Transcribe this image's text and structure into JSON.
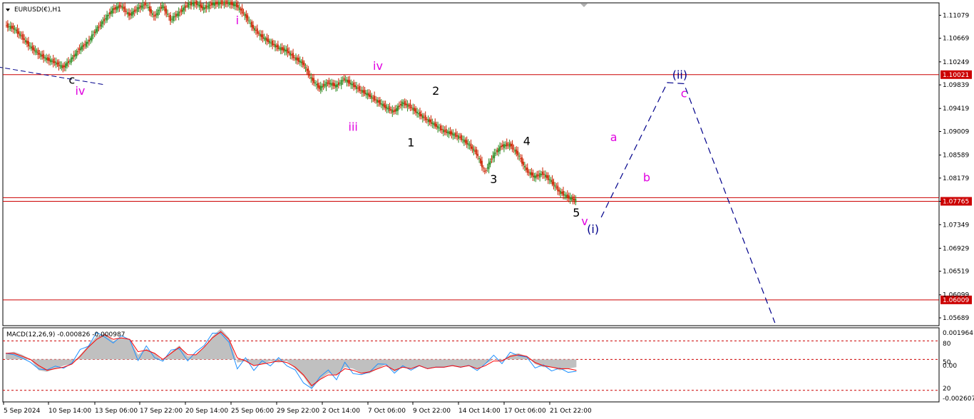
{
  "window": {
    "symbol_label": "EURUSD(€),H1",
    "indicator_label": "MACD(12,26,9) -0.000826 -0.000987"
  },
  "chart_data": [
    {
      "type": "line",
      "title": "EURUSD(€),H1",
      "yaxis_ticks": [
        "1.11079",
        "1.10669",
        "1.10249",
        "1.09839",
        "1.09419",
        "1.09009",
        "1.08589",
        "1.08179",
        "1.07765",
        "1.07349",
        "1.06929",
        "1.06519",
        "1.06099",
        "1.05689"
      ],
      "xaxis_ticks": [
        "5 Sep 2024",
        "10 Sep 14:00",
        "13 Sep 06:00",
        "17 Sep 22:00",
        "20 Sep 14:00",
        "25 Sep 06:00",
        "29 Sep 22:00",
        "2 Oct 14:00",
        "7 Oct 06:00",
        "9 Oct 22:00",
        "14 Oct 14:00",
        "17 Oct 06:00",
        "21 Oct 22:00"
      ],
      "ylim": [
        1.0555,
        1.113
      ],
      "price_path": [
        [
          0,
          1.109
        ],
        [
          1,
          1.1085
        ],
        [
          2,
          1.107
        ],
        [
          3,
          1.1052
        ],
        [
          4,
          1.104
        ],
        [
          5,
          1.103
        ],
        [
          6,
          1.1024
        ],
        [
          7,
          1.1015
        ],
        [
          8,
          1.103
        ],
        [
          9,
          1.1048
        ],
        [
          10,
          1.106
        ],
        [
          11,
          1.1082
        ],
        [
          12,
          1.11
        ],
        [
          13,
          1.1118
        ],
        [
          14,
          1.1125
        ],
        [
          15,
          1.1108
        ],
        [
          16,
          1.112
        ],
        [
          17,
          1.1128
        ],
        [
          18,
          1.1105
        ],
        [
          19,
          1.1125
        ],
        [
          20,
          1.11
        ],
        [
          21,
          1.1112
        ],
        [
          22,
          1.1126
        ],
        [
          23,
          1.113
        ],
        [
          24,
          1.112
        ],
        [
          25,
          1.1128
        ],
        [
          26,
          1.113
        ],
        [
          27,
          1.113
        ],
        [
          28,
          1.1125
        ],
        [
          29,
          1.1108
        ],
        [
          30,
          1.1085
        ],
        [
          31,
          1.107
        ],
        [
          32,
          1.106
        ],
        [
          33,
          1.105
        ],
        [
          34,
          1.1045
        ],
        [
          35,
          1.1032
        ],
        [
          36,
          1.1022
        ],
        [
          37,
          1.0995
        ],
        [
          38,
          1.0978
        ],
        [
          39,
          1.0988
        ],
        [
          40,
          1.0982
        ],
        [
          41,
          1.0994
        ],
        [
          42,
          1.0984
        ],
        [
          43,
          1.0974
        ],
        [
          44,
          1.0965
        ],
        [
          45,
          1.0955
        ],
        [
          46,
          1.0944
        ],
        [
          47,
          1.0936
        ],
        [
          48,
          1.0952
        ],
        [
          49,
          1.0945
        ],
        [
          50,
          1.0932
        ],
        [
          51,
          1.0922
        ],
        [
          52,
          1.0912
        ],
        [
          53,
          1.0902
        ],
        [
          54,
          1.0897
        ],
        [
          55,
          1.089
        ],
        [
          56,
          1.0878
        ],
        [
          57,
          1.0862
        ],
        [
          58,
          1.0828
        ],
        [
          59,
          1.0858
        ],
        [
          60,
          1.0875
        ],
        [
          61,
          1.0878
        ],
        [
          62,
          1.086
        ],
        [
          63,
          1.0832
        ],
        [
          64,
          1.082
        ],
        [
          65,
          1.0826
        ],
        [
          66,
          1.0812
        ],
        [
          67,
          1.0794
        ],
        [
          68,
          1.0784
        ],
        [
          69,
          1.0778
        ]
      ],
      "levels": [
        {
          "value": 1.10021,
          "label": "1.10021",
          "color": "#cc0000"
        },
        {
          "value": 1.07765,
          "label": "1.07765",
          "color": "#cc0000"
        },
        {
          "value": 1.0783,
          "label": "",
          "color": "#cc0000"
        },
        {
          "value": 1.06009,
          "label": "1.06009",
          "color": "#cc0000"
        }
      ],
      "projection": {
        "color": "#00008b",
        "points": [
          [
            72,
            1.0748
          ],
          [
            80,
            1.0988
          ],
          [
            82,
            1.0986
          ],
          [
            93,
            1.056
          ]
        ]
      },
      "trendline": {
        "color": "#00008b",
        "points": [
          [
            -1,
            1.1016
          ],
          [
            12,
            1.0984
          ]
        ]
      },
      "wave_labels": [
        {
          "text": "i",
          "x": 28,
          "y": 1.1092,
          "color": "#e000e0"
        },
        {
          "text": "c",
          "x": 8,
          "y": 1.0986,
          "color": "#000000"
        },
        {
          "text": "iv",
          "x": 9,
          "y": 1.0966,
          "color": "#e000e0"
        },
        {
          "text": "iv",
          "x": 45,
          "y": 1.1011,
          "color": "#e000e0"
        },
        {
          "text": "iii",
          "x": 42,
          "y": 1.0902,
          "color": "#e000e0"
        },
        {
          "text": "1",
          "x": 49,
          "y": 1.0874,
          "color": "#000000"
        },
        {
          "text": "2",
          "x": 52,
          "y": 1.0966,
          "color": "#000000"
        },
        {
          "text": "3",
          "x": 59,
          "y": 1.0809,
          "color": "#000000"
        },
        {
          "text": "4",
          "x": 63,
          "y": 1.0877,
          "color": "#000000"
        },
        {
          "text": "5",
          "x": 69,
          "y": 1.0749,
          "color": "#000000"
        },
        {
          "text": "v",
          "x": 70,
          "y": 1.0734,
          "color": "#e000e0"
        },
        {
          "text": "(i)",
          "x": 71,
          "y": 1.072,
          "color": "#00008b"
        },
        {
          "text": "a",
          "x": 73.5,
          "y": 1.0884,
          "color": "#e000e0"
        },
        {
          "text": "b",
          "x": 77.5,
          "y": 1.0812,
          "color": "#e000e0"
        },
        {
          "text": "(ii)",
          "x": 81.5,
          "y": 1.0995,
          "color": "#00008b"
        },
        {
          "text": "c",
          "x": 82,
          "y": 1.0962,
          "color": "#e000e0"
        }
      ]
    },
    {
      "type": "line",
      "title": "MACD(12,26,9) -0.000826 -0.000987",
      "yaxis_ticks": [
        "0.001964",
        "80",
        "50",
        "0.00",
        "20",
        "-0.002607"
      ],
      "ylim": [
        -0.00275,
        0.00205
      ],
      "levels": [
        0.0012,
        0.0,
        -0.002
      ],
      "macd_histogram": [
        0.0004,
        0.0005,
        0.0003,
        0.0,
        -0.0007,
        -0.0008,
        -0.0006,
        -0.0004,
        -0.0003,
        0.0003,
        0.0009,
        0.0015,
        0.0017,
        0.0012,
        0.0014,
        0.0013,
        0.0003,
        0.0007,
        0.0004,
        -0.0001,
        0.0005,
        0.0009,
        0.0002,
        0.0003,
        0.0008,
        0.0015,
        0.002,
        0.0014,
        -0.0002,
        -0.0001,
        -0.0004,
        -0.0003,
        -0.0001,
        -0.0002,
        -0.0001,
        -0.0006,
        -0.0011,
        -0.0019,
        -0.0013,
        -0.0009,
        -0.001,
        -0.0005,
        -0.0006,
        -0.0009,
        -0.0009,
        -0.0006,
        -0.0003,
        -0.0008,
        -0.0005,
        -0.0006,
        -0.0004,
        -0.0006,
        -0.0005,
        -0.0005,
        -0.0004,
        -0.0005,
        -0.0004,
        -0.0006,
        -0.0003,
        0.0,
        -0.0001,
        0.0003,
        0.0004,
        0.0002,
        -0.0003,
        -0.0005,
        -0.0005,
        -0.0007,
        -0.0006,
        -0.0005
      ],
      "macd_line": [
        0.0004,
        0.0003,
        0.0001,
        -0.0002,
        -0.0006,
        -0.0007,
        -0.0004,
        -0.0006,
        -0.0002,
        0.0006,
        0.0009,
        0.0017,
        0.0015,
        0.001,
        0.0016,
        0.0012,
        0.0,
        0.0008,
        0.0002,
        -0.0002,
        0.0007,
        0.0006,
        0.0,
        0.0004,
        0.001,
        0.0016,
        0.0018,
        0.001,
        -0.0005,
        0.0,
        -0.0006,
        -0.0002,
        -0.0003,
        0.0,
        -0.0003,
        -0.0008,
        -0.0014,
        -0.002,
        -0.001,
        -0.0008,
        -0.0012,
        -0.0003,
        -0.0008,
        -0.0011,
        -0.0007,
        -0.0004,
        -0.0002,
        -0.001,
        -0.0003,
        -0.0008,
        -0.0003,
        -0.0007,
        -0.0004,
        -0.0006,
        -0.0003,
        -0.0006,
        -0.0003,
        -0.0008,
        -0.0002,
        0.0002,
        -0.0002,
        0.0004,
        0.0003,
        0.0001,
        -0.0005,
        -0.0004,
        -0.0007,
        -0.0006,
        -0.0008,
        -0.0008
      ],
      "signal_line": [
        0.0004,
        0.0004,
        0.0002,
        0.0,
        -0.0004,
        -0.0007,
        -0.0006,
        -0.0005,
        -0.0003,
        0.0002,
        0.0008,
        0.0013,
        0.0016,
        0.0013,
        0.0014,
        0.0013,
        0.0005,
        0.0006,
        0.0004,
        0.0,
        0.0004,
        0.0008,
        0.0003,
        0.0003,
        0.0008,
        0.0014,
        0.0018,
        0.0013,
        0.0001,
        -0.0001,
        -0.0004,
        -0.0003,
        -0.0002,
        -0.0001,
        -0.0002,
        -0.0005,
        -0.001,
        -0.0017,
        -0.0013,
        -0.001,
        -0.001,
        -0.0006,
        -0.0007,
        -0.0009,
        -0.0008,
        -0.0006,
        -0.0004,
        -0.0007,
        -0.0005,
        -0.0006,
        -0.0004,
        -0.0006,
        -0.0005,
        -0.0005,
        -0.0004,
        -0.0005,
        -0.0004,
        -0.0006,
        -0.0004,
        -0.0001,
        -0.0001,
        0.0002,
        0.0003,
        0.0002,
        -0.0002,
        -0.0004,
        -0.0005,
        -0.0006,
        -0.0006,
        -0.0007
      ],
      "histogram_color": "#c0c0c0",
      "macd_color": "#1e90ff",
      "signal_color": "#ff0000"
    }
  ],
  "colors": {
    "grid_border": "#000000",
    "bull_candle": "#2e8b22",
    "bear_candle": "#cc2200",
    "level_line": "#cc0000"
  }
}
